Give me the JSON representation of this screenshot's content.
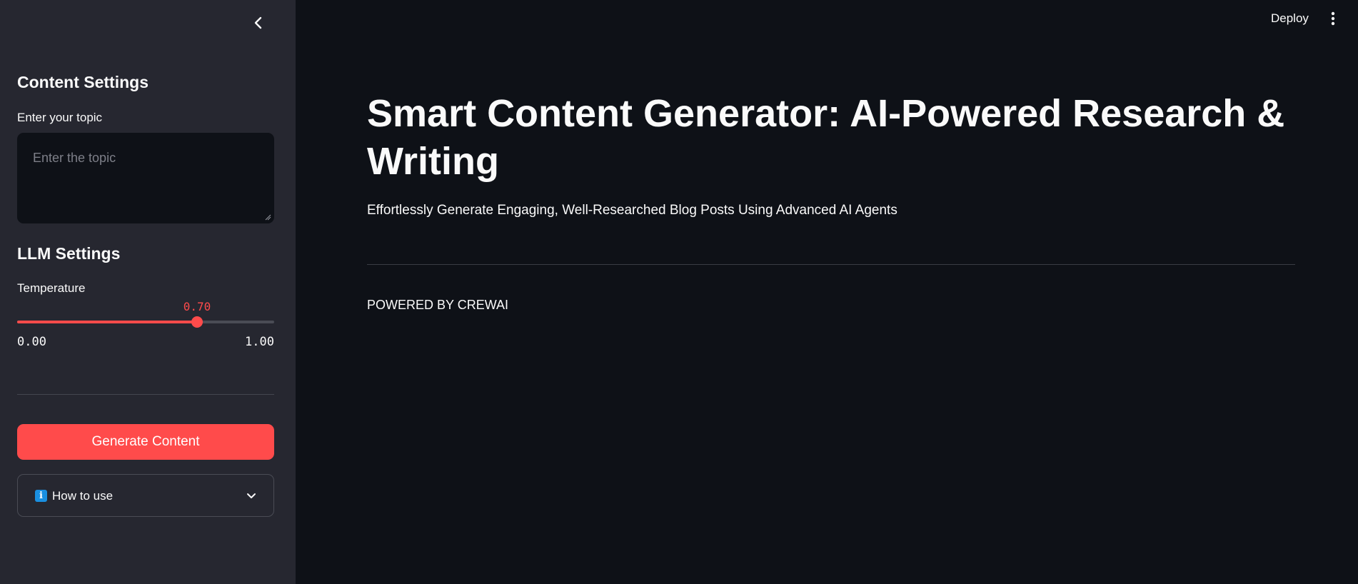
{
  "colors": {
    "background": "#0e1117",
    "sidebar": "#262730",
    "accent": "#ff4b4b",
    "text": "#fafafa",
    "placeholder": "#7d7f88",
    "info_icon": "#1a8fe0"
  },
  "sidebar": {
    "collapse_icon": "chevron-left-icon",
    "content_settings": {
      "heading": "Content Settings",
      "topic_label": "Enter your topic",
      "topic_placeholder": "Enter the topic",
      "topic_value": ""
    },
    "llm_settings": {
      "heading": "LLM Settings",
      "temperature": {
        "label": "Temperature",
        "value": 0.7,
        "value_text": "0.70",
        "min": 0.0,
        "max": 1.0,
        "min_text": "0.00",
        "max_text": "1.00"
      }
    },
    "generate_button": "Generate Content",
    "how_to_use": {
      "icon": "info-icon",
      "label": "How to use",
      "expanded": false
    }
  },
  "header": {
    "deploy_label": "Deploy",
    "menu_icon": "kebab-menu-icon"
  },
  "main": {
    "title": "Smart Content Generator: AI-Powered Research & Writing",
    "subtitle": "Effortlessly Generate Engaging, Well-Researched Blog Posts Using Advanced AI Agents",
    "powered_by": "POWERED BY CREWAI"
  }
}
